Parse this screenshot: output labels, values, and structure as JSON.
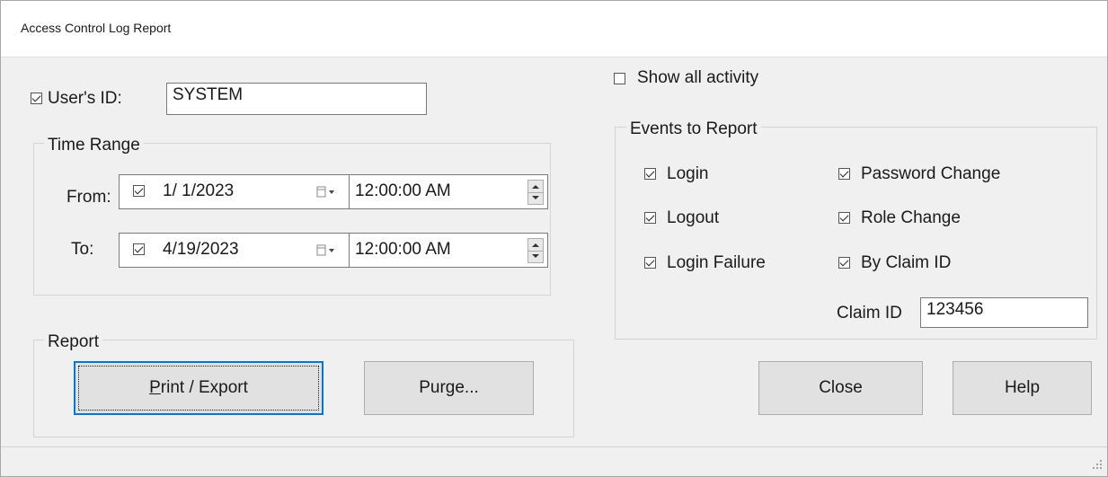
{
  "window": {
    "title": "Access Control Log Report"
  },
  "user_id": {
    "checked": true,
    "label": "User's ID:",
    "value": "SYSTEM"
  },
  "time_range": {
    "title": "Time Range",
    "from": {
      "label": "From:",
      "checked": true,
      "date": "1/ 1/2023",
      "time": "12:00:00 AM"
    },
    "to": {
      "label": "To:",
      "checked": true,
      "date": "4/19/2023",
      "time": "12:00:00 AM"
    }
  },
  "report": {
    "title": "Report",
    "print_label_mnemonic": "P",
    "print_label_rest": "rint / Export",
    "purge_label": "Purge..."
  },
  "show_all": {
    "checked": false,
    "label": "Show all activity"
  },
  "events": {
    "title": "Events to Report",
    "login": {
      "checked": true,
      "label": "Login"
    },
    "logout": {
      "checked": true,
      "label": "Logout"
    },
    "login_failure": {
      "checked": true,
      "label": "Login Failure"
    },
    "password_change": {
      "checked": true,
      "label": "Password Change"
    },
    "role_change": {
      "checked": true,
      "label": "Role Change"
    },
    "by_claim_id": {
      "checked": true,
      "label": "By Claim ID"
    },
    "claim_id_label": "Claim ID",
    "claim_id_value": "123456"
  },
  "buttons": {
    "close_label": "Close",
    "help_label": "Help"
  },
  "colors": {
    "accent": "#0078d7",
    "window_bg": "#f0f0f0"
  }
}
